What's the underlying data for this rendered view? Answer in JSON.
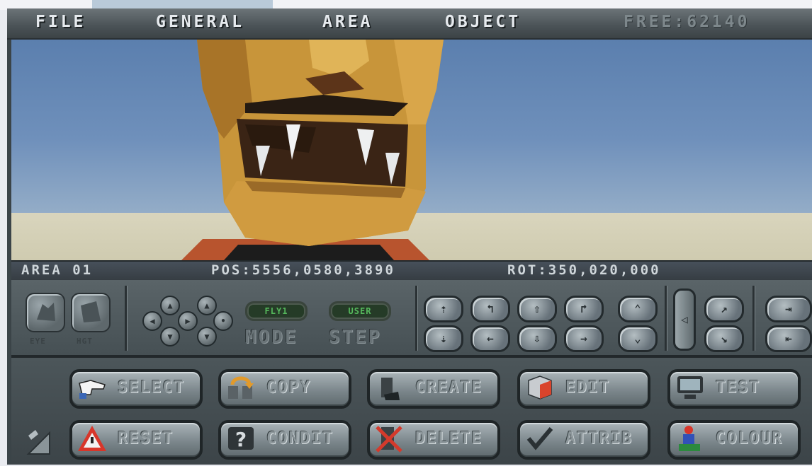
{
  "menu": {
    "file": "FILE",
    "general": "GENERAL",
    "area": "AREA",
    "object": "OBJECT",
    "free": "FREE:62140"
  },
  "status": {
    "area": "AREA 01",
    "pos": "POS:5556,0580,3890",
    "rot": "ROT:350,020,000"
  },
  "panel": {
    "led1": "FLY1",
    "led2": "USER",
    "mode": "MODE",
    "step": "STEP",
    "cam_label1": "EYE",
    "cam_label2": "HGT"
  },
  "commands": {
    "select": "SELECT",
    "copy": "COPY",
    "create": "CREATE",
    "edit": "EDIT",
    "test": "TEST",
    "reset": "RESET",
    "condit": "CONDIT",
    "delete": "DELETE",
    "attrib": "ATTRIB",
    "colour": "COLOUR"
  },
  "colors": {
    "sky": "#6f90bb",
    "ground": "#d9d5bd",
    "face": "#c8953a",
    "panel": "#5a6468",
    "led": "#55b85c"
  },
  "icons": {
    "select": "pointing-hand-icon",
    "copy": "copy-arrow-icon",
    "create": "create-block-icon",
    "edit": "edit-cube-icon",
    "test": "monitor-icon",
    "reset": "warning-triangle-icon",
    "condit": "question-mark-icon",
    "delete": "cross-out-icon",
    "attrib": "checkmark-icon",
    "colour": "paint-figure-icon"
  }
}
